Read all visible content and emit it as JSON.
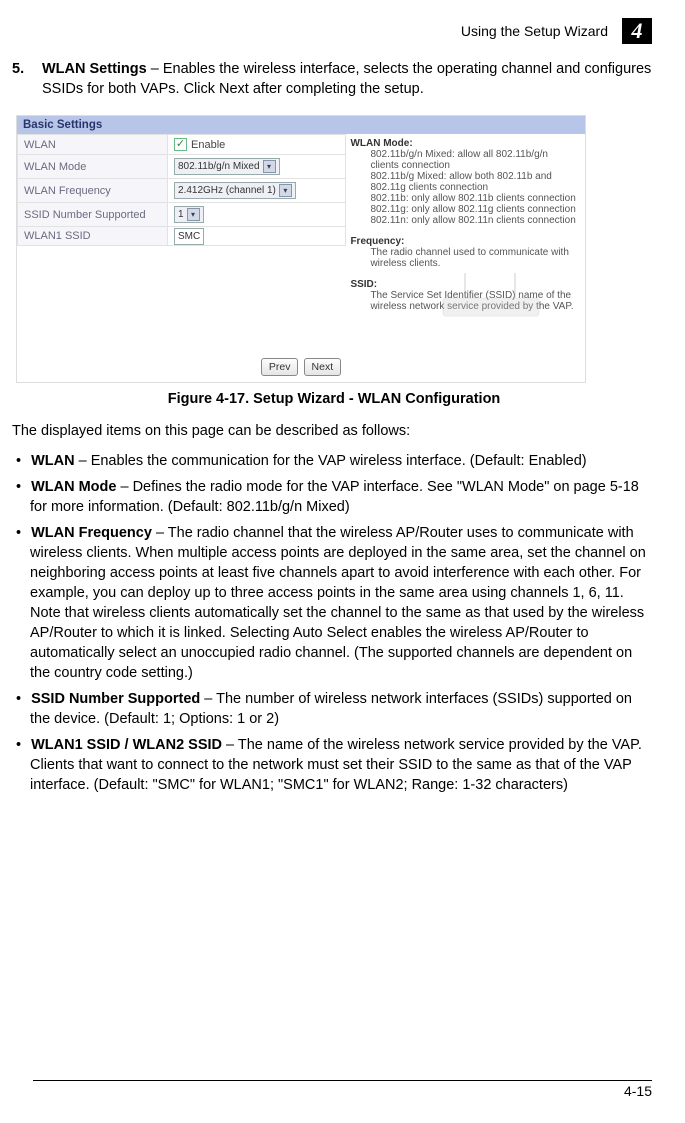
{
  "header": {
    "title": "Using the Setup Wizard",
    "chapter": "4"
  },
  "step": {
    "number": "5.",
    "title": "WLAN Settings",
    "text": " – Enables the wireless interface, selects the operating channel and configures SSIDs for both VAPs. Click Next after completing the setup."
  },
  "figure": {
    "bar_title": "Basic Settings",
    "rows": {
      "wlan_label": "WLAN",
      "enable_label": "Enable",
      "mode_label": "WLAN Mode",
      "mode_value": "802.11b/g/n Mixed",
      "freq_label": "WLAN Frequency",
      "freq_value": "2.412GHz (channel 1)",
      "ssid_num_label": "SSID Number Supported",
      "ssid_num_value": "1",
      "ssid_label": "WLAN1 SSID",
      "ssid_value": "SMC"
    },
    "help": {
      "mode_title": "WLAN Mode:",
      "mode_line1": "802.11b/g/n Mixed: allow all 802.11b/g/n clients connection",
      "mode_line2": "802.11b/g Mixed: allow both 802.11b and 802.11g clients connection",
      "mode_line3": "802.11b: only allow 802.11b clients connection",
      "mode_line4": "802.11g: only allow 802.11g clients connection",
      "mode_line5": "802.11n: only allow 802.11n clients connection",
      "freq_title": "Frequency:",
      "freq_text": "The radio channel used to communicate with wireless clients.",
      "ssid_title": "SSID:",
      "ssid_text": "The Service Set Identifier (SSID) name of the wireless network service provided by the VAP."
    },
    "buttons": {
      "prev": "Prev",
      "next": "Next"
    },
    "caption": "Figure 4-17.   Setup Wizard - WLAN Configuration"
  },
  "intro": "The displayed items on this page can be described as follows:",
  "bullets": {
    "b1_term": "WLAN",
    "b1_text": " – Enables the communication for the VAP wireless interface. (Default: Enabled)",
    "b2_term": "WLAN Mode",
    "b2_text": " – Defines the radio mode for the VAP interface. See \"WLAN Mode\" on page 5-18 for more information. (Default: 802.11b/g/n Mixed)",
    "b3_term": "WLAN Frequency",
    "b3_text": " – The radio channel that the wireless AP/Router uses to communicate with wireless clients. When multiple access points are deployed in the same area, set the channel on neighboring access points at least five channels apart to avoid interference with each other. For example, you can deploy up to three access points in the same area using channels 1, 6, 11. Note that wireless clients automatically set the channel to the same as that used by the wireless AP/Router to which it is linked. Selecting Auto Select enables the wireless AP/Router to automatically select an unoccupied radio channel. (The supported channels are dependent on the country code setting.)",
    "b4_term": "SSID Number Supported",
    "b4_text": " – The number of wireless network interfaces (SSIDs) supported on the device. (Default: 1; Options: 1 or 2)",
    "b5_term": "WLAN1 SSID / WLAN2 SSID",
    "b5_text": " – The name of the wireless network service provided by the VAP. Clients that want to connect to the network must set their SSID to the same as that of the VAP interface. (Default: \"SMC\" for WLAN1; \"SMC1\" for WLAN2; Range: 1-32 characters)"
  },
  "footer": {
    "page": "4-15"
  }
}
